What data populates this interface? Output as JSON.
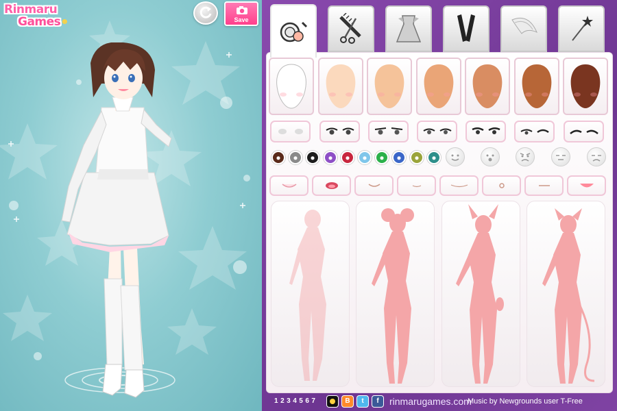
{
  "game": {
    "logo_line1": "Rinmaru",
    "logo_line2": "Games"
  },
  "toolbar": {
    "save_label": "Save",
    "reset_icon": "reset-icon",
    "save_icon": "camera-icon"
  },
  "tabs": [
    {
      "name": "makeup",
      "icon": "makeup-compact-icon",
      "active": true
    },
    {
      "name": "hair",
      "icon": "comb-scissors-icon",
      "active": false
    },
    {
      "name": "dress",
      "icon": "dress-icon",
      "active": false
    },
    {
      "name": "accessories",
      "icon": "gloves-icon",
      "active": false
    },
    {
      "name": "wings",
      "icon": "wing-icon",
      "active": false
    },
    {
      "name": "wand",
      "icon": "wand-icon",
      "active": false
    }
  ],
  "skin_tones": [
    "#ffffff",
    "#fbd9bd",
    "#f5c39a",
    "#eaa577",
    "#d98d62",
    "#b76637",
    "#7a3520"
  ],
  "eye_color_swatches": [
    "#5a2a1a",
    "#8a8a8a",
    "#1c1c1c",
    "#8e4fc6",
    "#c8263e",
    "#7fc6ea",
    "#2bb04a",
    "#3a66c8",
    "#9aa43a",
    "#2d8f8a"
  ],
  "expressions": [
    "smile-face-icon",
    "surprised-face-icon",
    "angry-face-icon",
    "neutral-face-icon",
    "sad-face-icon"
  ],
  "body_types": [
    "human-silhouette",
    "mouse-ears-silhouette",
    "horns-silhouette",
    "cat-tail-silhouette"
  ],
  "colors": {
    "accent_pink": "#ff4f9a",
    "panel_purple": "#7a3f9e",
    "silhouette": "#f4a6a8"
  },
  "footer": {
    "pages": [
      "1",
      "2",
      "3",
      "4",
      "5",
      "6",
      "7"
    ],
    "site": "rinmarugames.com",
    "music_credit": "Music by Newgrounds user T-Free"
  }
}
